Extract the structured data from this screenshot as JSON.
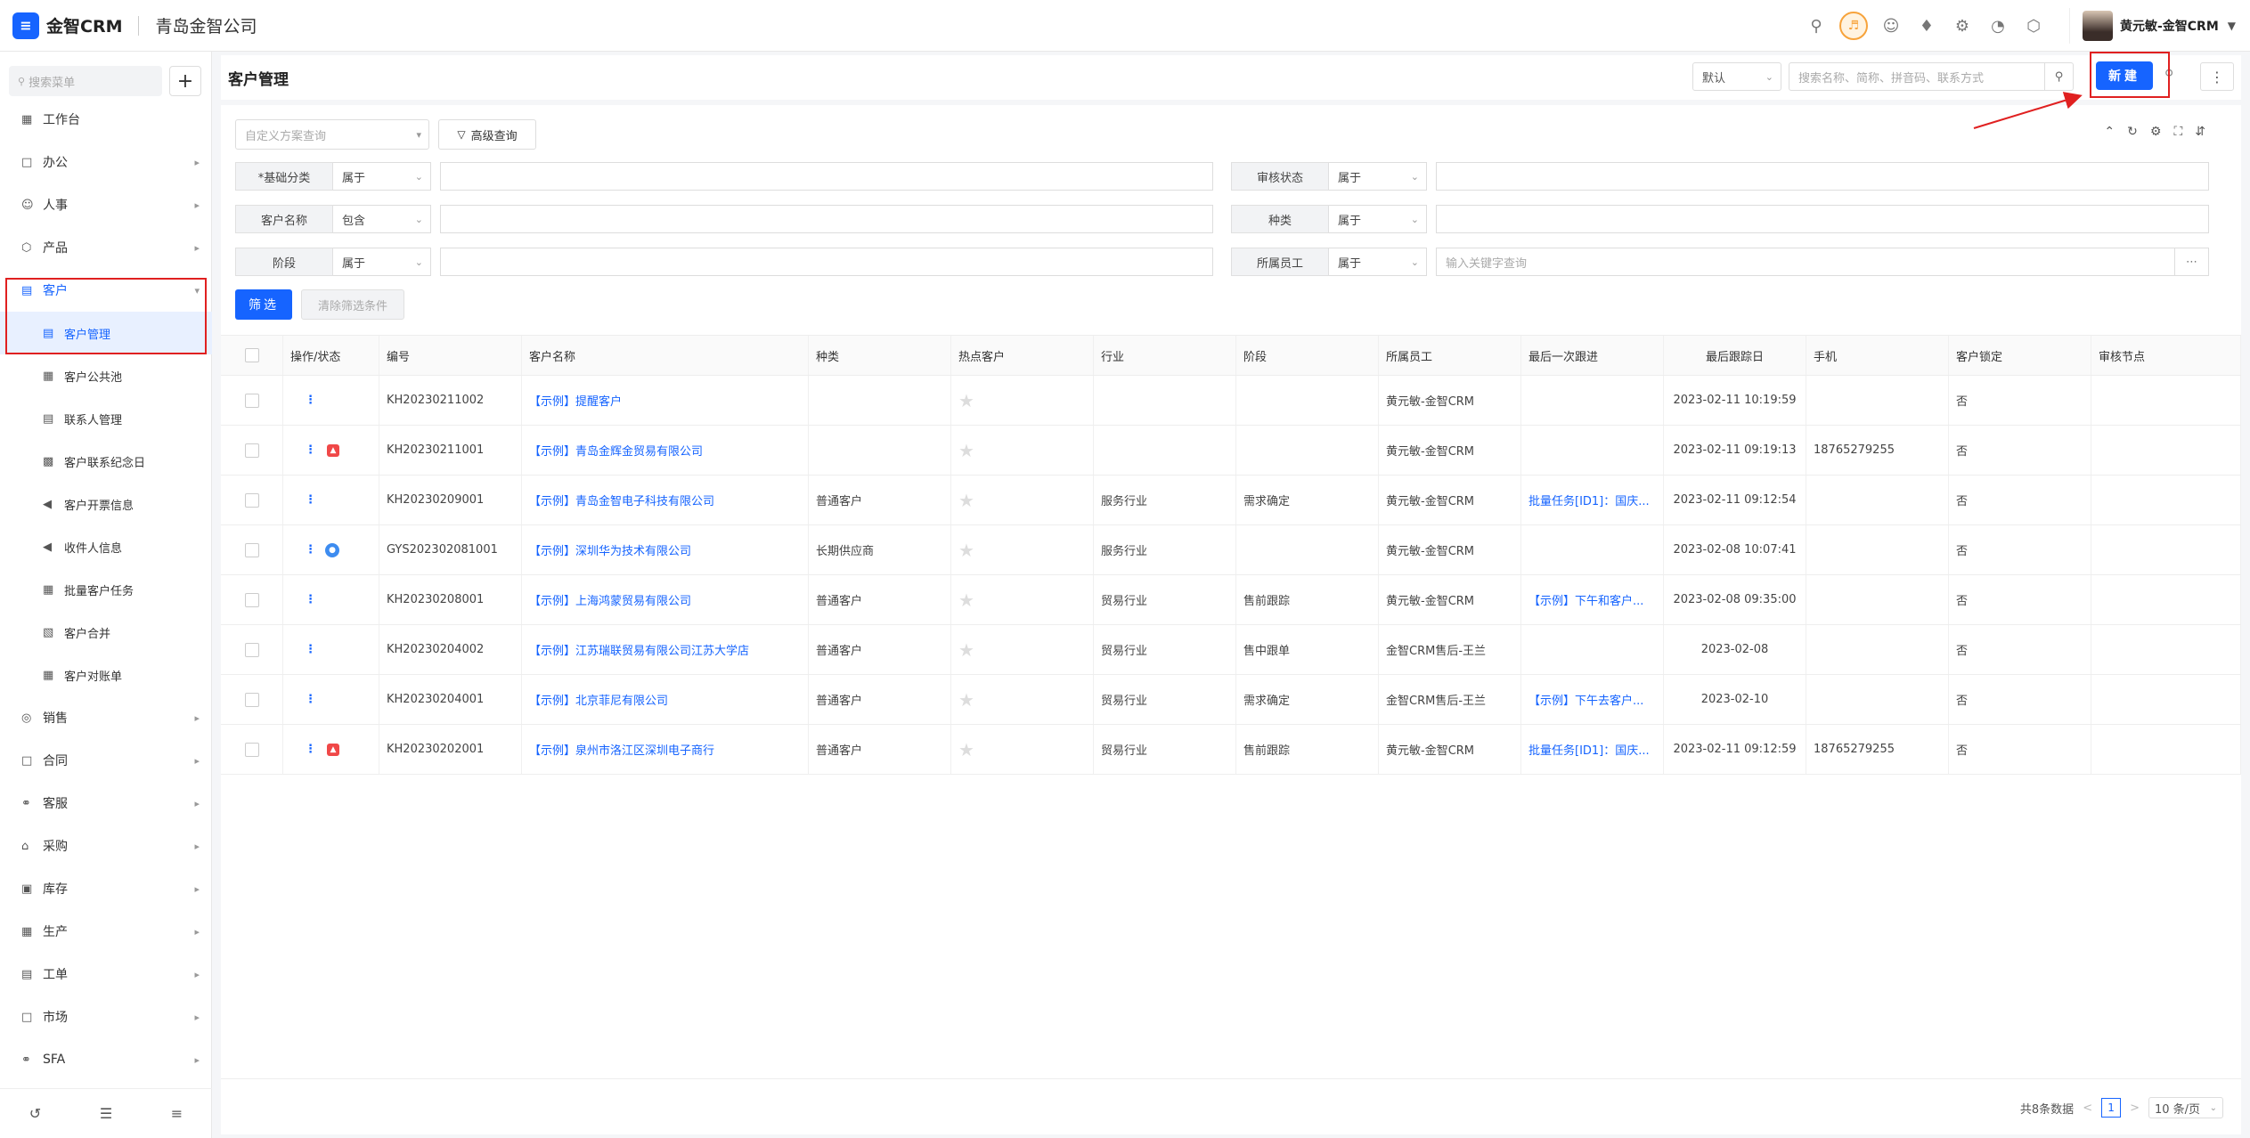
{
  "topbar": {
    "logo_glyph": "≡",
    "app_name": "金智CRM",
    "company": "青岛金智公司",
    "user_name": "黄元敏-金智CRM"
  },
  "sidebar": {
    "search_placeholder": "搜索菜单",
    "add_label": "+",
    "items": [
      {
        "label": "工作台",
        "icon": "dashboard-icon"
      },
      {
        "label": "办公",
        "icon": "office-icon"
      },
      {
        "label": "人事",
        "icon": "hr-icon"
      },
      {
        "label": "产品",
        "icon": "product-icon"
      },
      {
        "label": "客户",
        "icon": "customer-icon"
      },
      {
        "label": "客户管理",
        "icon": "customer-manage-icon"
      },
      {
        "label": "客户公共池",
        "icon": "pool-icon"
      },
      {
        "label": "联系人管理",
        "icon": "contact-icon"
      },
      {
        "label": "客户联系纪念日",
        "icon": "calendar-icon"
      },
      {
        "label": "客户开票信息",
        "icon": "invoice-icon"
      },
      {
        "label": "收件人信息",
        "icon": "recipient-icon"
      },
      {
        "label": "批量客户任务",
        "icon": "task-icon"
      },
      {
        "label": "客户合并",
        "icon": "merge-icon"
      },
      {
        "label": "客户对账单",
        "icon": "statement-icon"
      },
      {
        "label": "销售",
        "icon": "sales-icon"
      },
      {
        "label": "合同",
        "icon": "contract-icon"
      },
      {
        "label": "客服",
        "icon": "service-icon"
      },
      {
        "label": "采购",
        "icon": "purchase-icon"
      },
      {
        "label": "库存",
        "icon": "inventory-icon"
      },
      {
        "label": "生产",
        "icon": "production-icon"
      },
      {
        "label": "工单",
        "icon": "workorder-icon"
      },
      {
        "label": "市场",
        "icon": "market-icon"
      },
      {
        "label": "SFA",
        "icon": "sfa-icon"
      }
    ]
  },
  "header": {
    "title": "客户管理",
    "view_select": "默认",
    "search_placeholder": "搜索名称、简称、拼音码、联系方式",
    "new_label": "新建"
  },
  "filters": {
    "scheme_placeholder": "自定义方案查询",
    "advanced_label": "高级查询",
    "rows": [
      {
        "label": "*基础分类",
        "op": "属于",
        "value": ""
      },
      {
        "label": "审核状态",
        "op": "属于",
        "value": ""
      },
      {
        "label": "客户名称",
        "op": "包含",
        "value": ""
      },
      {
        "label": "种类",
        "op": "属于",
        "value": ""
      },
      {
        "label": "阶段",
        "op": "属于",
        "value": ""
      },
      {
        "label": "所属员工",
        "op": "属于",
        "value": "输入关键字查询"
      }
    ],
    "filter_btn": "筛选",
    "clear_btn": "清除筛选条件"
  },
  "table": {
    "columns": [
      "操作/状态",
      "编号",
      "客户名称",
      "种类",
      "热点客户",
      "行业",
      "阶段",
      "所属员工",
      "最后一次跟进",
      "最后跟踪日",
      "手机",
      "客户锁定",
      "审核节点"
    ],
    "rows": [
      {
        "code": "KH20230211002",
        "name": "【示例】提醒客户",
        "kind": "",
        "industry": "",
        "stage": "",
        "staff": "黄元敏-金智CRM",
        "last_follow": "",
        "last_date": "2023-02-11 10:19:59",
        "phone": "",
        "locked": "否",
        "badge": ""
      },
      {
        "code": "KH20230211001",
        "name": "【示例】青岛金辉金贸易有限公司",
        "kind": "",
        "industry": "",
        "stage": "",
        "staff": "黄元敏-金智CRM",
        "last_follow": "",
        "last_date": "2023-02-11 09:19:13",
        "phone": "18765279255",
        "locked": "否",
        "badge": "red"
      },
      {
        "code": "KH20230209001",
        "name": "【示例】青岛金智电子科技有限公司",
        "kind": "普通客户",
        "industry": "服务行业",
        "stage": "需求确定",
        "staff": "黄元敏-金智CRM",
        "last_follow": "批量任务[ID1]：国庆...",
        "last_date": "2023-02-11 09:12:54",
        "phone": "",
        "locked": "否",
        "badge": ""
      },
      {
        "code": "GYS202302081001",
        "name": "【示例】深圳华为技术有限公司",
        "kind": "长期供应商",
        "industry": "服务行业",
        "stage": "",
        "staff": "黄元敏-金智CRM",
        "last_follow": "",
        "last_date": "2023-02-08 10:07:41",
        "phone": "",
        "locked": "否",
        "badge": "blue"
      },
      {
        "code": "KH20230208001",
        "name": "【示例】上海鸿蒙贸易有限公司",
        "kind": "普通客户",
        "industry": "贸易行业",
        "stage": "售前跟踪",
        "staff": "黄元敏-金智CRM",
        "last_follow": "【示例】下午和客户...",
        "last_date": "2023-02-08 09:35:00",
        "phone": "",
        "locked": "否",
        "badge": ""
      },
      {
        "code": "KH20230204002",
        "name": "【示例】江苏瑞联贸易有限公司江苏大学店",
        "kind": "普通客户",
        "industry": "贸易行业",
        "stage": "售中跟单",
        "staff": "金智CRM售后-王兰",
        "last_follow": "",
        "last_date": "2023-02-08",
        "phone": "",
        "locked": "否",
        "badge": ""
      },
      {
        "code": "KH20230204001",
        "name": "【示例】北京菲尼有限公司",
        "kind": "普通客户",
        "industry": "贸易行业",
        "stage": "需求确定",
        "staff": "金智CRM售后-王兰",
        "last_follow": "【示例】下午去客户...",
        "last_date": "2023-02-10",
        "phone": "",
        "locked": "否",
        "badge": ""
      },
      {
        "code": "KH20230202001",
        "name": "【示例】泉州市洛江区深圳电子商行",
        "kind": "普通客户",
        "industry": "贸易行业",
        "stage": "售前跟踪",
        "staff": "黄元敏-金智CRM",
        "last_follow": "批量任务[ID1]：国庆...",
        "last_date": "2023-02-11 09:12:59",
        "phone": "18765279255",
        "locked": "否",
        "badge": "red"
      }
    ]
  },
  "pager": {
    "total": "共8条数据",
    "prev": "<",
    "page": "1",
    "next": ">",
    "size": "10 条/页"
  },
  "colors": {
    "accent": "#1664ff",
    "annotation": "#e02020"
  }
}
